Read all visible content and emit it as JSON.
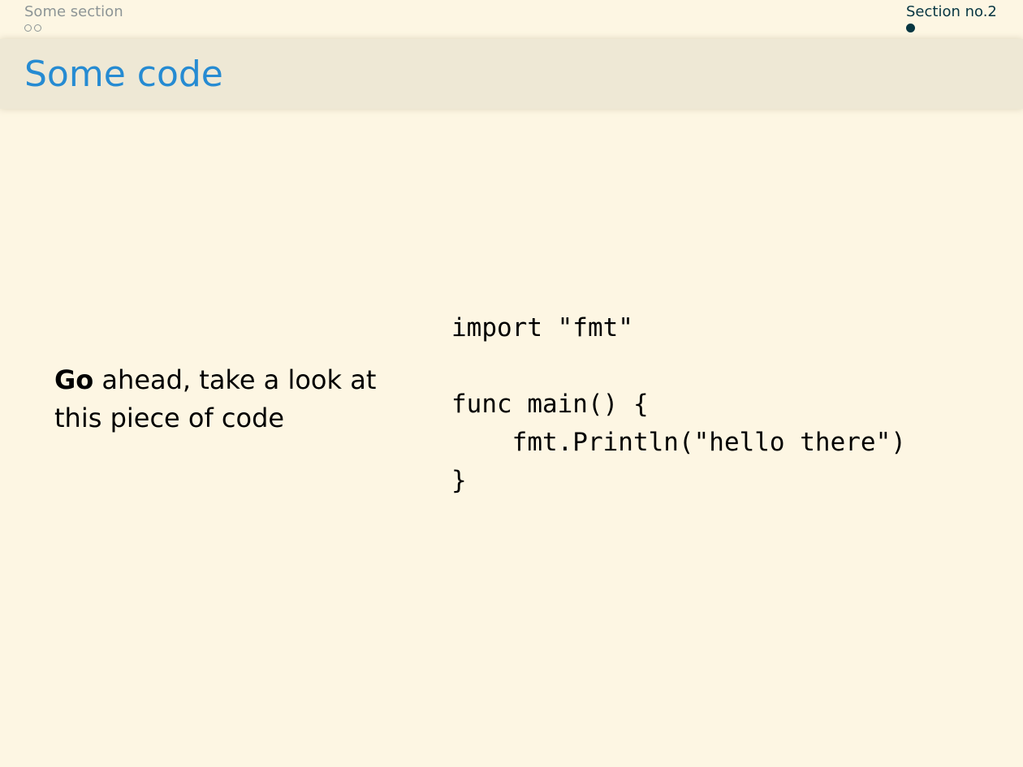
{
  "nav": {
    "sections": [
      {
        "label": "Some section",
        "dots": 2,
        "active_dot": -1
      },
      {
        "label": "Section no.2",
        "dots": 1,
        "active_dot": 0
      }
    ]
  },
  "frame": {
    "title": "Some code"
  },
  "content": {
    "text_bold": "Go",
    "text_rest": " ahead, take a look at this piece of code",
    "code": "import \"fmt\"\n\nfunc main() {\n    fmt.Println(\"hello there\")\n}"
  },
  "colors": {
    "background": "#fdf6e3",
    "titlebar": "#eee8d5",
    "title": "#268bd2",
    "nav_active": "#073642",
    "nav_inactive": "#8d9596"
  }
}
